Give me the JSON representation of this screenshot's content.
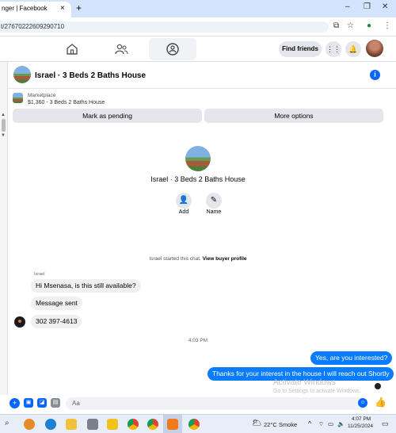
{
  "browser": {
    "tab_title": "nger | Facebook",
    "tab_close": "×",
    "new_tab": "+",
    "minimize": "–",
    "restore": "❐",
    "close": "✕",
    "url": "t/27670222609290710"
  },
  "nav": {
    "find_friends": "Find friends"
  },
  "chat": {
    "title": "Israel · 3 Beds 2 Baths House",
    "marketplace_label": "Marketplace",
    "listing": "$1,360 - 3 Beds 2 Baths House",
    "mark_pending": "Mark as pending",
    "more_options": "More options",
    "profile_name": "Israel · 3 Beds 2 Baths House",
    "add_label": "Add",
    "name_label": "Name",
    "started_text": "Israel started this chat.",
    "view_profile": "View buyer profile",
    "sender": "Israel",
    "messages_in": [
      "Hi Msenasa, is this still available?",
      "Message sent",
      "302 397-4613"
    ],
    "timestamp": "4:03 PM",
    "messages_out": [
      "Yes, are you interested?",
      "Thanks for your interest in the house I will reach out Shortly"
    ],
    "composer_placeholder": "Aa"
  },
  "watermark": {
    "line1": "Activate Windows",
    "line2": "Go to Settings to activate Windows."
  },
  "taskbar": {
    "weather": "22°C  Smoke",
    "time": "4:07 PM",
    "date": "11/25/2024"
  },
  "colors": {
    "accent": "#0866ff",
    "outgoing_bubble": "#0a7cff",
    "incoming_bubble": "#f0f0f0"
  }
}
